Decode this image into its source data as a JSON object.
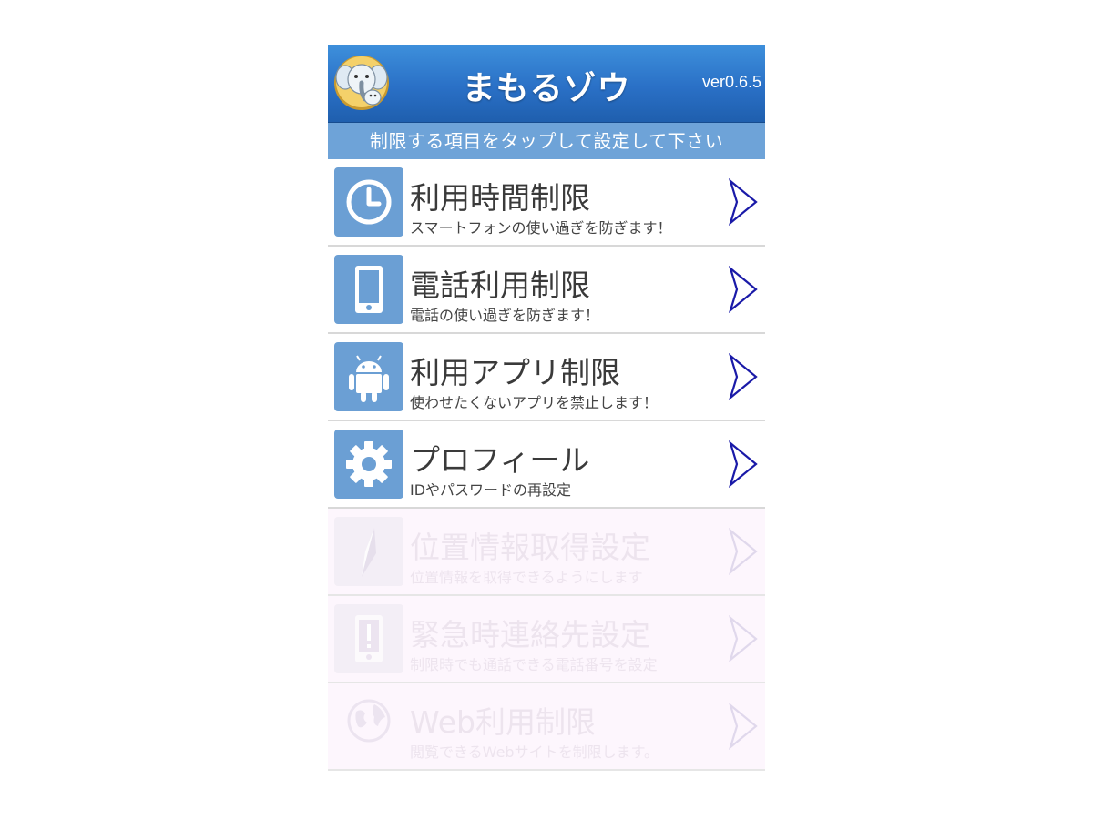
{
  "app": {
    "title": "まもるゾウ",
    "version": "ver0.6.5",
    "instruction": "制限する項目をタップして設定して下さい"
  },
  "menu": [
    {
      "title": "利用時間制限",
      "subtitle": "スマートフォンの使い過ぎを防ぎます！",
      "icon": "clock-icon",
      "enabled": true
    },
    {
      "title": "電話利用制限",
      "subtitle": "電話の使い過ぎを防ぎます！",
      "icon": "phone-icon",
      "enabled": true
    },
    {
      "title": "利用アプリ制限",
      "subtitle": "使わせたくないアプリを禁止します！",
      "icon": "android-icon",
      "enabled": true
    },
    {
      "title": "プロフィール",
      "subtitle": "IDやパスワードの再設定",
      "icon": "gear-icon",
      "enabled": true
    },
    {
      "title": "位置情報取得設定",
      "subtitle": "位置情報を取得できるようにします",
      "icon": "compass-icon",
      "enabled": false
    },
    {
      "title": "緊急時連絡先設定",
      "subtitle": "制限時でも通話できる電話番号を設定",
      "icon": "emergency-phone-icon",
      "enabled": false
    },
    {
      "title": "Web利用制限",
      "subtitle": "閲覧できるWebサイトを制限します。",
      "icon": "globe-icon",
      "enabled": false
    }
  ],
  "colors": {
    "header_blue": "#2a70c6",
    "instruction_bar": "#6ea3d8",
    "icon_tile": "#6b9fd4",
    "chevron_enabled": "#1a1aa8",
    "chevron_disabled": "#e0d8ec",
    "disabled_row_bg": "#fdf6fd"
  }
}
